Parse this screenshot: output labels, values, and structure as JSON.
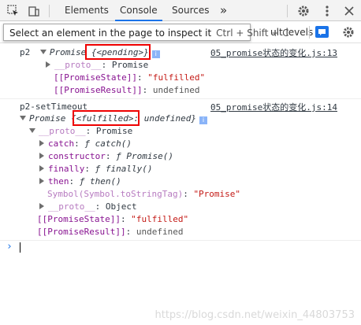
{
  "tabs": [
    {
      "label": "Elements"
    },
    {
      "label": "Console"
    },
    {
      "label": "Sources"
    }
  ],
  "more_tabs_icon": "»",
  "tooltip": {
    "text": "Select an element in the page to inspect it",
    "shortcut": "Ctrl + Shift + C"
  },
  "levels_label": "ult levels ▼",
  "log1": {
    "label": "p2",
    "promise_word": "Promise",
    "state_preview": "{<pending>}",
    "source": "05_promise状态的变化.js:13",
    "proto_label": "__proto__",
    "proto_value": "Promise",
    "state_key": "[[PromiseState]]",
    "state_value": "\"fulfilled\"",
    "result_key": "[[PromiseResult]]",
    "result_value": "undefined"
  },
  "log2": {
    "label": "p2-setTimeout",
    "source": "05_promise状态的变化.js:14",
    "promise_word": "Promise",
    "brace_open": "{",
    "fulfilled_key": "<fulfilled>",
    "fulfilled_rest": ": undefined}",
    "proto_label": "__proto__",
    "proto_value": "Promise",
    "methods": [
      {
        "key": "catch",
        "value": "ƒ catch()"
      },
      {
        "key": "constructor",
        "value": "ƒ Promise()"
      },
      {
        "key": "finally",
        "value": "ƒ finally()"
      },
      {
        "key": "then",
        "value": "ƒ then()"
      }
    ],
    "symbol_key": "Symbol(Symbol.toStringTag)",
    "symbol_value": "\"Promise\"",
    "inner_proto_label": "__proto__",
    "inner_proto_value": "Object",
    "state_key": "[[PromiseState]]",
    "state_value": "\"fulfilled\"",
    "result_key": "[[PromiseResult]]",
    "result_value": "undefined"
  },
  "prompt_symbol": "›",
  "watermark": "https://blog.csdn.net/weixin_44803753",
  "colors": {
    "accent": "#1a73e8",
    "highlight_box": "#e00000"
  }
}
